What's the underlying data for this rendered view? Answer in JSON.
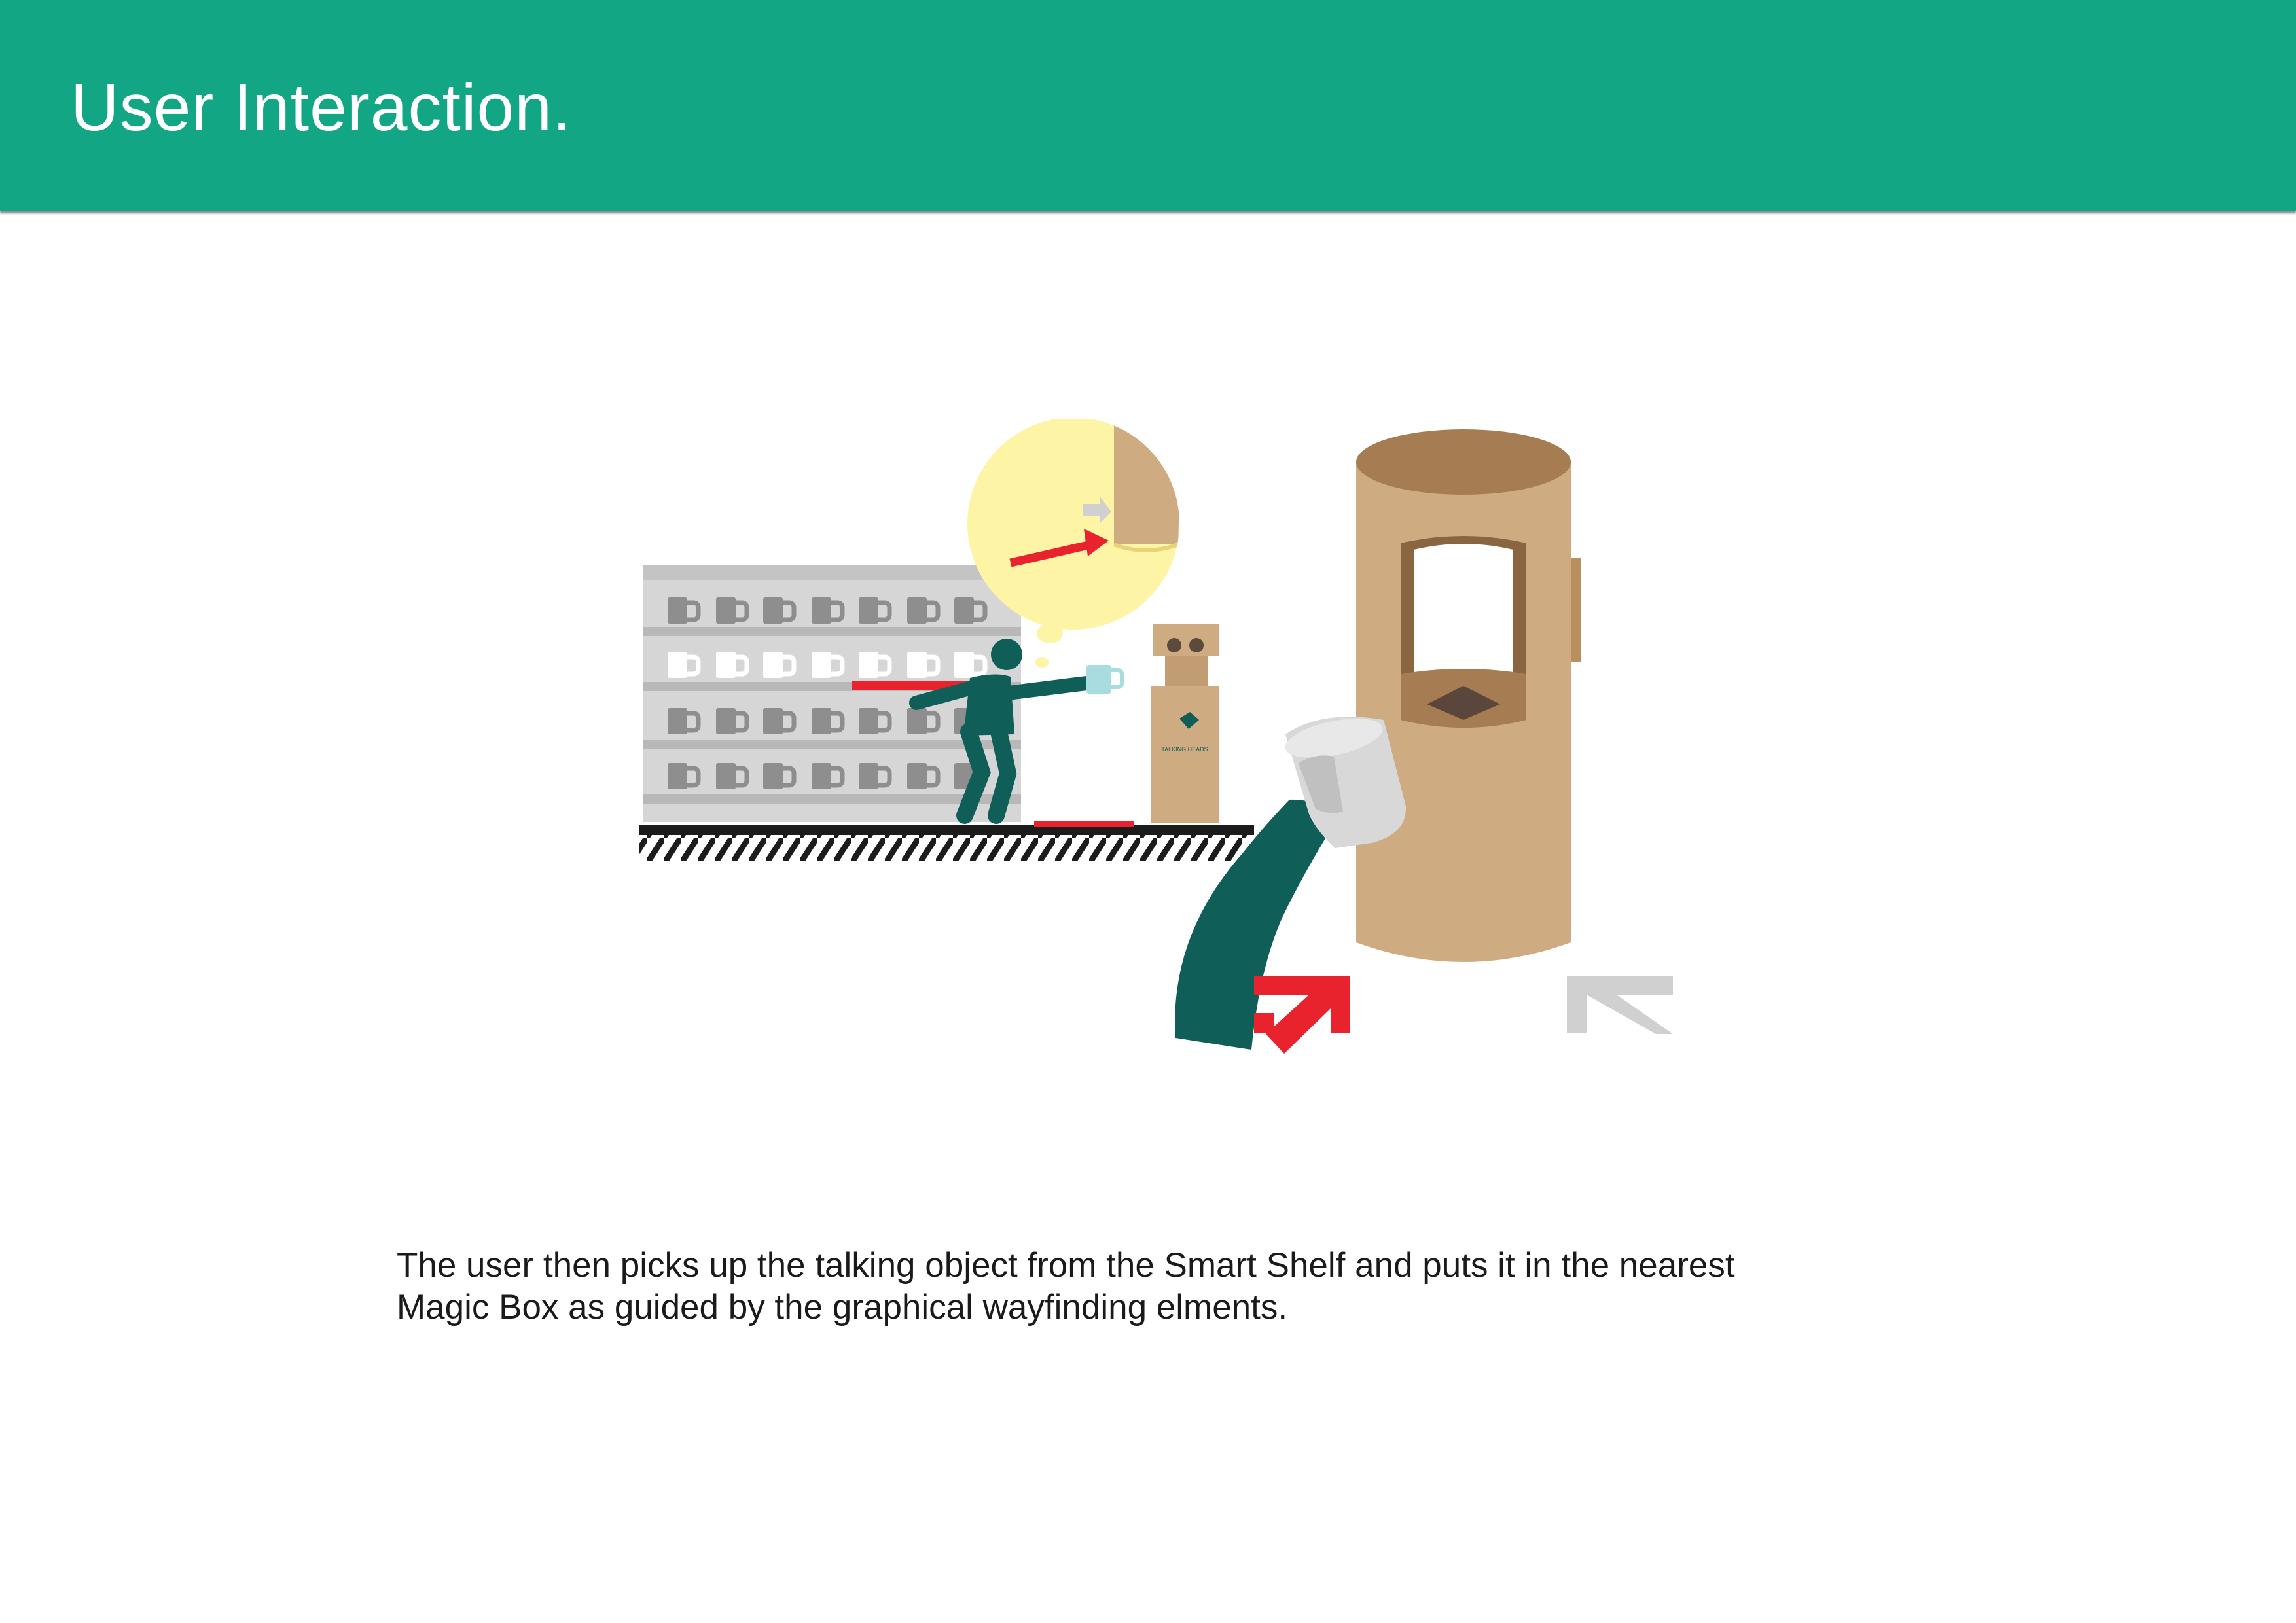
{
  "header": {
    "title": "User Interaction.",
    "background_color": "#12a685"
  },
  "illustration": {
    "box_label": "TALKING HEADS",
    "colors": {
      "figure": "#0f5e58",
      "arrow_red": "#e8232d",
      "arrow_gray": "#d0d0d0",
      "cardboard": "#cfab82",
      "cardboard_dark": "#a67d52",
      "thought_bubble": "#fdf4a6",
      "shelf": "#d6d6d6"
    },
    "icons": [
      "smart-shelf",
      "mug-icon",
      "person-figure",
      "thought-bubble",
      "talking-object-box",
      "magic-box",
      "hand-holding-mug",
      "arrow-icon"
    ]
  },
  "caption": {
    "line1": "The user then picks up the talking object from the Smart Shelf and puts it in the nearest",
    "line2": "Magic Box as guided by the graphical wayfinding elments."
  }
}
